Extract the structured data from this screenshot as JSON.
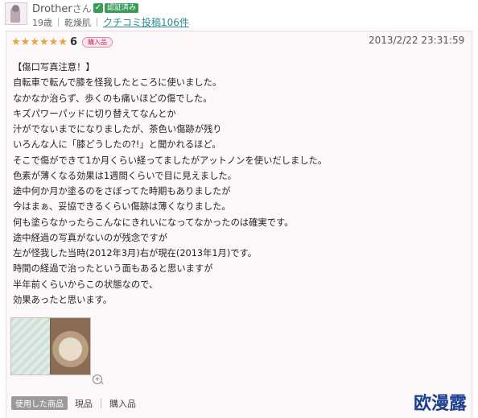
{
  "user": {
    "name": "Drother",
    "honorific": "さん",
    "verified_label": "認証済み",
    "age": "19歳",
    "skin_type": "乾燥肌",
    "review_count_link": "クチコミ投稿106件"
  },
  "review": {
    "stars": 6,
    "score": "6",
    "purchase_badge": "購入品",
    "timestamp": "2013/2/22 23:31:59",
    "lines": [
      "【傷口写真注意！】",
      "自転車で転んで膝を怪我したところに使いました。",
      "なかなか治らず、歩くのも痛いほどの傷でした。",
      "キズパワーパッドに切り替えてなんとか",
      "汁がでないまでになりましたが、茶色い傷跡が残り",
      "いろんな人に「膝どうしたの?!」と聞かれるほど。",
      "そこで傷ができて1か月くらい経ってましたがアットノンを使いだしました。",
      "色素が薄くなる効果は1週間くらいで目に見えました。",
      "途中何か月か塗るのをさぼってた時期もありましたが",
      "今はまぁ、妥協できるくらい傷跡は薄くなりました。",
      "何も塗らなかったらこんなにきれいになってなかったのは確実です。",
      "途中経過の写真がないのが残念ですが",
      "左が怪我した当時(2012年3月)右が現在(2013年1月)です。",
      "時間の経過で治ったという面もあると思いますが",
      "半年前くらいからこの状態なので、",
      "効果あったと思います。"
    ]
  },
  "footer": {
    "used_tag": "使用した商品",
    "items": [
      "現品",
      "購入品"
    ]
  },
  "watermark": "欧漫露",
  "colors": {
    "star": "#e8a33d",
    "verified": "#3a9a5a",
    "link": "#2a8c8c",
    "watermark": "#1d3f8f"
  }
}
